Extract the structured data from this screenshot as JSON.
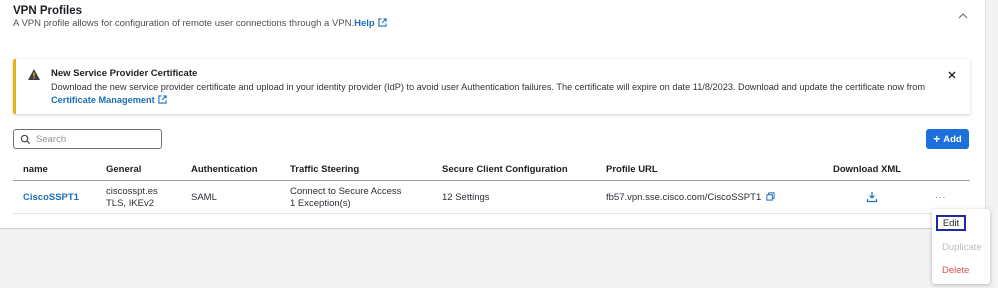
{
  "section": {
    "title": "VPN Profiles",
    "description": "A VPN profile allows for configuration of remote user connections through a VPN.",
    "help_label": "Help"
  },
  "banner": {
    "title": "New Service Provider Certificate",
    "message": "Download the new service provider certificate and upload in your identity provider (IdP) to avoid user Authentication failures. The certificate will expire on date 11/8/2023. Download and update the certificate now from",
    "link_label": "Certificate Management",
    "accent_color": "#e2b21a"
  },
  "toolbar": {
    "search_placeholder": "Search",
    "search_value": "",
    "add_label": "Add",
    "add_color": "#1d6fdb"
  },
  "table": {
    "columns": [
      "name",
      "General",
      "Authentication",
      "Traffic Steering",
      "Secure Client Configuration",
      "Profile URL",
      "Download XML"
    ],
    "rows": [
      {
        "name": "CiscoSSPT1",
        "general_line1": "ciscosspt.es",
        "general_line2": "TLS, IKEv2",
        "authentication": "SAML",
        "traffic_line1": "Connect to Secure Access",
        "traffic_line2": "1 Exception(s)",
        "secure_client": "12 Settings",
        "profile_url": "fb57.vpn.sse.cisco.com/CiscoSSPT1",
        "more_label": "..."
      }
    ]
  },
  "context_menu": {
    "items": [
      "Edit",
      "Duplicate",
      "Delete"
    ],
    "delete_color": "#d9534f",
    "disabled_color": "#b8bcc1"
  },
  "icons": [
    "external-link-icon",
    "chevron-up-icon",
    "warning-icon",
    "close-icon",
    "search-icon",
    "plus-icon",
    "copy-icon",
    "download-icon",
    "more-icon"
  ]
}
